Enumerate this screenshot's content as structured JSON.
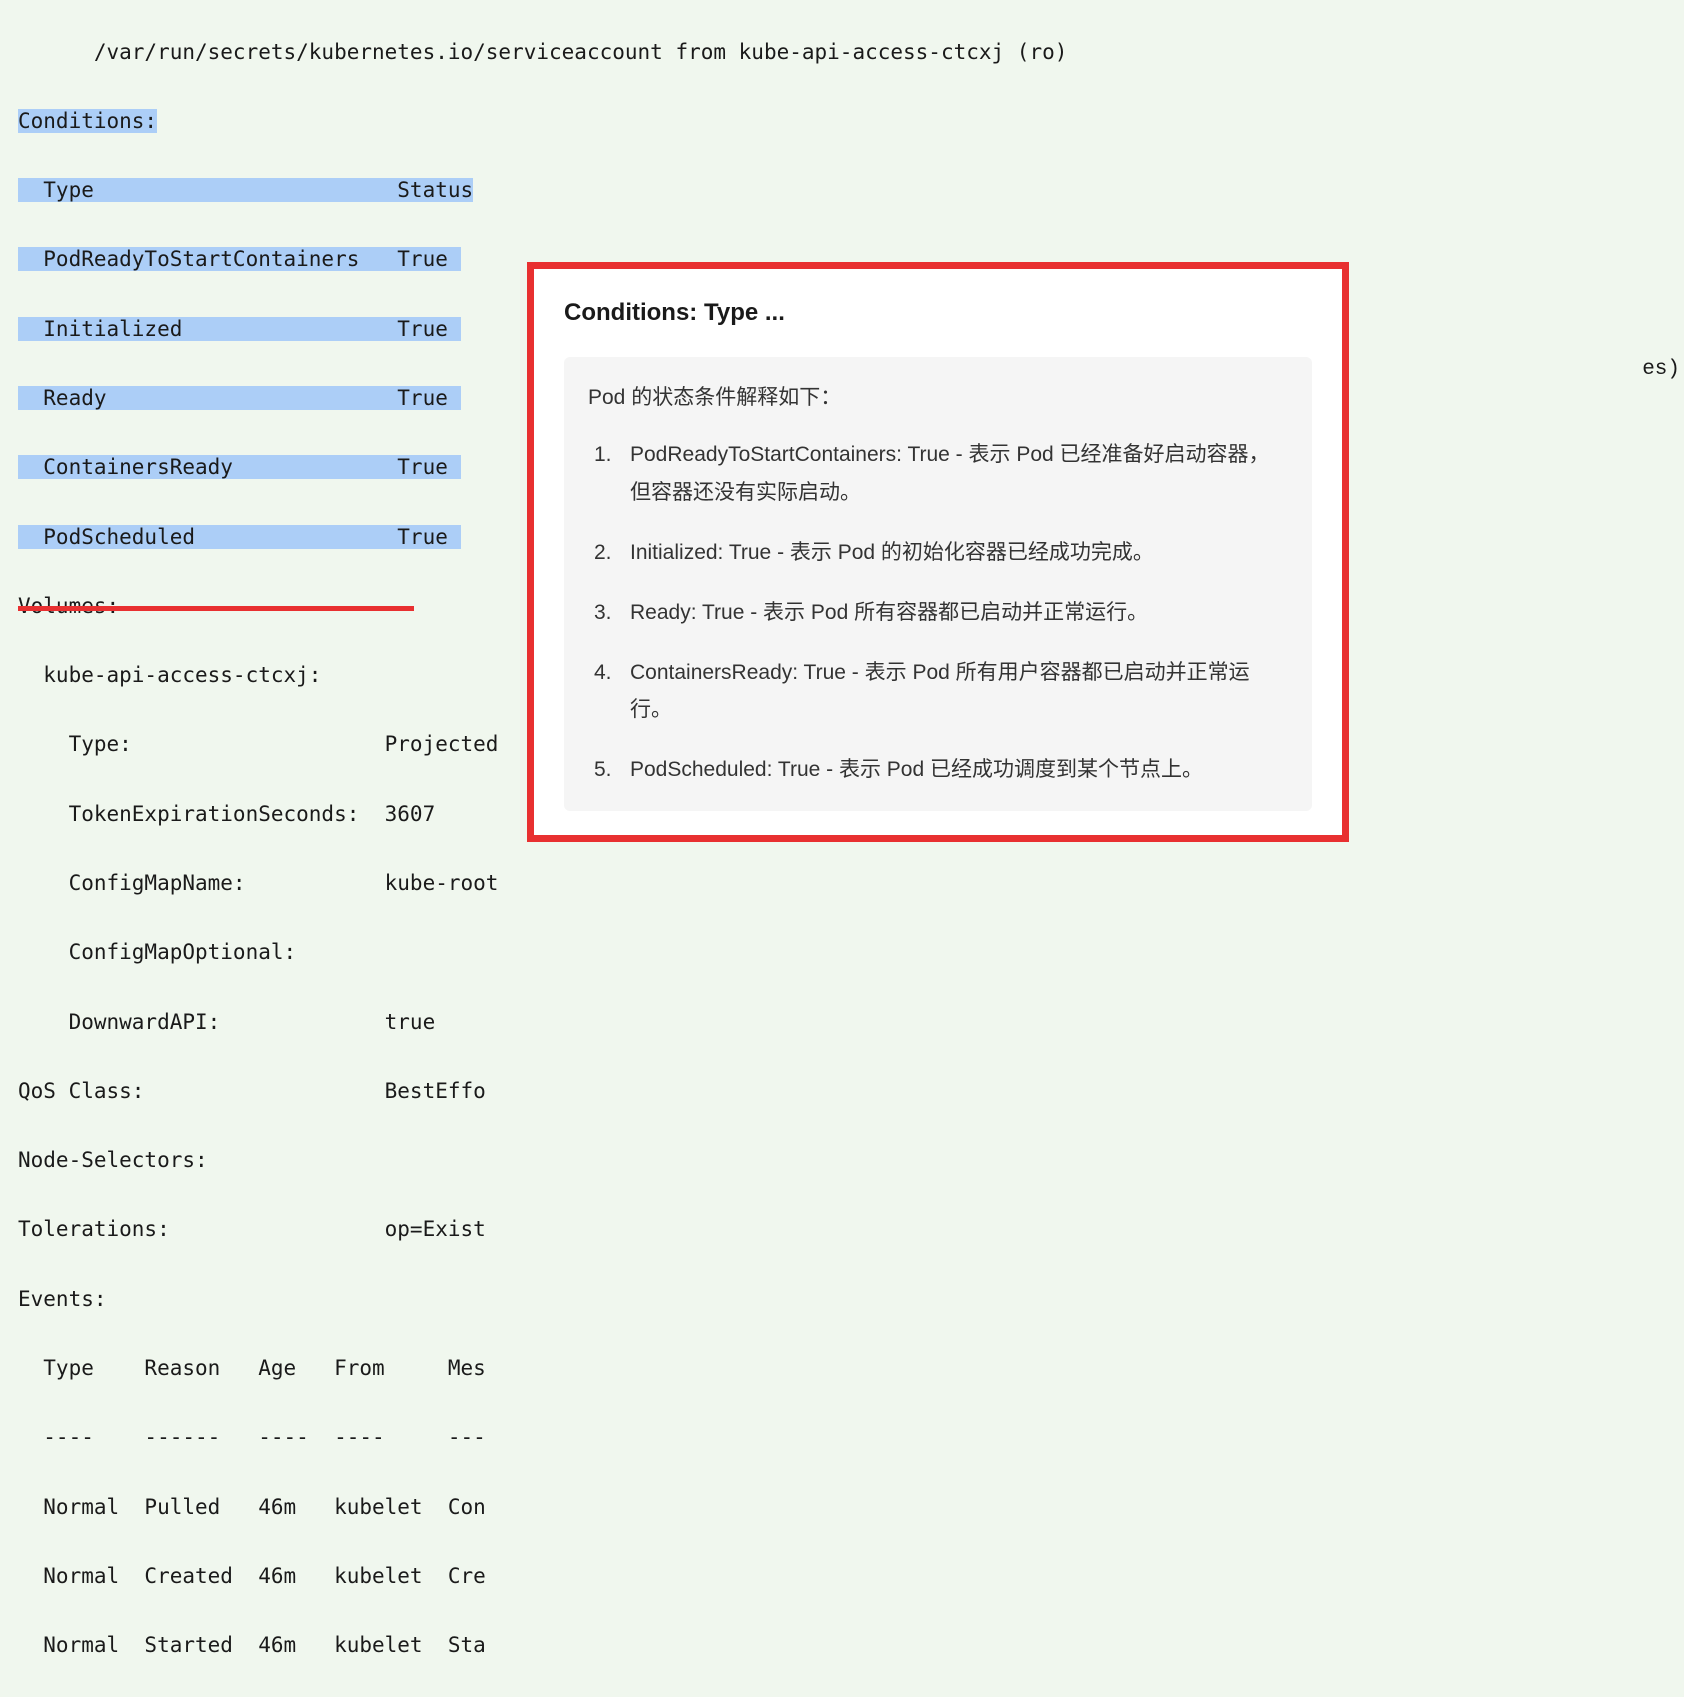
{
  "terminal": {
    "mount_line": "      /var/run/secrets/kubernetes.io/serviceaccount from kube-api-access-ctcxj (ro)",
    "conditions_header": "Conditions:",
    "conditions_cols": "  Type                        Status",
    "cond1": "  PodReadyToStartContainers   True ",
    "cond2": "  Initialized                 True ",
    "cond3": "  Ready                       True ",
    "cond4": "  ContainersReady             True ",
    "cond5": "  PodScheduled                True ",
    "volumes_header": "Volumes:",
    "vol_name": "  kube-api-access-ctcxj:",
    "vol_type": "    Type:                    Projected",
    "vol_token": "    TokenExpirationSeconds:  3607",
    "vol_cm_name": "    ConfigMapName:           kube-root",
    "vol_cm_opt": "    ConfigMapOptional:",
    "vol_downward": "    DownwardAPI:             true",
    "qos": "QoS Class:                   BestEffo",
    "node_sel": "Node-Selectors:",
    "tolerations": "Tolerations:                 op=Exist",
    "events_header": "Events:",
    "events_cols": "  Type    Reason   Age   From     Mes",
    "events_dash": "  ----    ------   ----  ----     ---",
    "ev1": "  Normal  Pulled   46m   kubelet  Con",
    "ev2": "  Normal  Created  46m   kubelet  Cre",
    "ev3": "  Normal  Started  46m   kubelet  Sta",
    "right_fragment": "es)"
  },
  "popup": {
    "title": "Conditions: Type ...",
    "intro": "Pod 的状态条件解释如下：",
    "items": [
      "PodReadyToStartContainers: True - 表示 Pod 已经准备好启动容器，但容器还没有实际启动。",
      "Initialized: True - 表示 Pod 的初始化容器已经成功完成。",
      "Ready: True - 表示 Pod 所有容器都已启动并正常运行。",
      "ContainersReady: True - 表示 Pod 所有用户容器都已启动并正常运行。",
      "PodScheduled: True - 表示 Pod 已经成功调度到某个节点上。"
    ]
  }
}
